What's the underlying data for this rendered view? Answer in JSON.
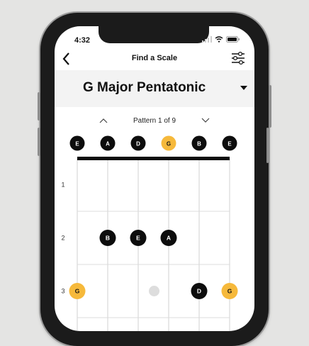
{
  "status": {
    "time": "4:32"
  },
  "nav": {
    "title": "Find a Scale",
    "back_icon": "chevron-left-icon",
    "filter_icon": "sliders-icon"
  },
  "scale": {
    "name": "G Major Pentatonic",
    "dropdown_icon": "caret-down-icon"
  },
  "pattern": {
    "label": "Pattern 1 of 9",
    "prev_icon": "chevron-up-icon",
    "next_icon": "chevron-down-icon"
  },
  "strings": [
    "E",
    "A",
    "D",
    "G",
    "B",
    "E"
  ],
  "root_string": "G",
  "frets": [
    "1",
    "2",
    "3"
  ],
  "notes": [
    {
      "string": 1,
      "fret": 2,
      "label": "B",
      "root": false
    },
    {
      "string": 2,
      "fret": 2,
      "label": "E",
      "root": false
    },
    {
      "string": 3,
      "fret": 2,
      "label": "A",
      "root": false
    },
    {
      "string": 0,
      "fret": 3,
      "label": "G",
      "root": true
    },
    {
      "string": 4,
      "fret": 3,
      "label": "D",
      "root": false
    },
    {
      "string": 5,
      "fret": 3,
      "label": "G",
      "root": true
    }
  ],
  "fret_markers": [
    {
      "fret": 3,
      "between": "D-G"
    }
  ],
  "colors": {
    "root": "#f6b93b",
    "note": "#0d0d0d",
    "background": "#e4e4e3",
    "header": "#f3f3f3",
    "marker": "#dddddd"
  }
}
